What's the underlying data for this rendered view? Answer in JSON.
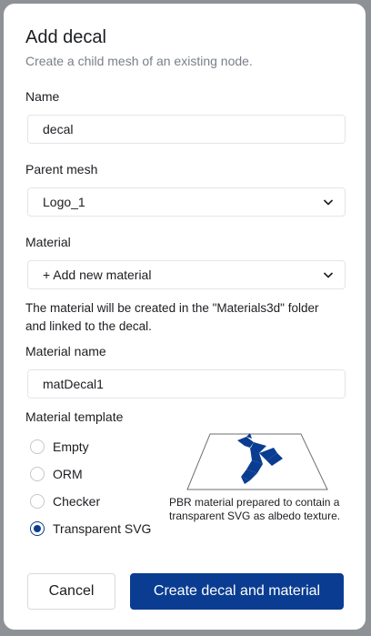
{
  "dialog": {
    "title": "Add decal",
    "subtitle": "Create a child mesh of an existing node."
  },
  "name": {
    "label": "Name",
    "value": "decal"
  },
  "parent_mesh": {
    "label": "Parent mesh",
    "selected": "Logo_1"
  },
  "material": {
    "label": "Material",
    "selected": "+ Add new material",
    "help": "The material will be created in the \"Materials3d\" folder and linked to the decal."
  },
  "material_name": {
    "label": "Material name",
    "value": "matDecal1"
  },
  "material_template": {
    "label": "Material template",
    "options": [
      {
        "label": "Empty",
        "checked": false
      },
      {
        "label": "ORM",
        "checked": false
      },
      {
        "label": "Checker",
        "checked": false
      },
      {
        "label": "Transparent SVG",
        "checked": true
      }
    ],
    "description": "PBR material prepared to contain a transparent SVG as albedo texture.",
    "preview_icon": "bird-logo-icon"
  },
  "buttons": {
    "cancel": "Cancel",
    "submit": "Create decal and material"
  },
  "colors": {
    "primary": "#0a3d91",
    "border": "#e3e5e8",
    "muted_text": "#7a7f86"
  }
}
